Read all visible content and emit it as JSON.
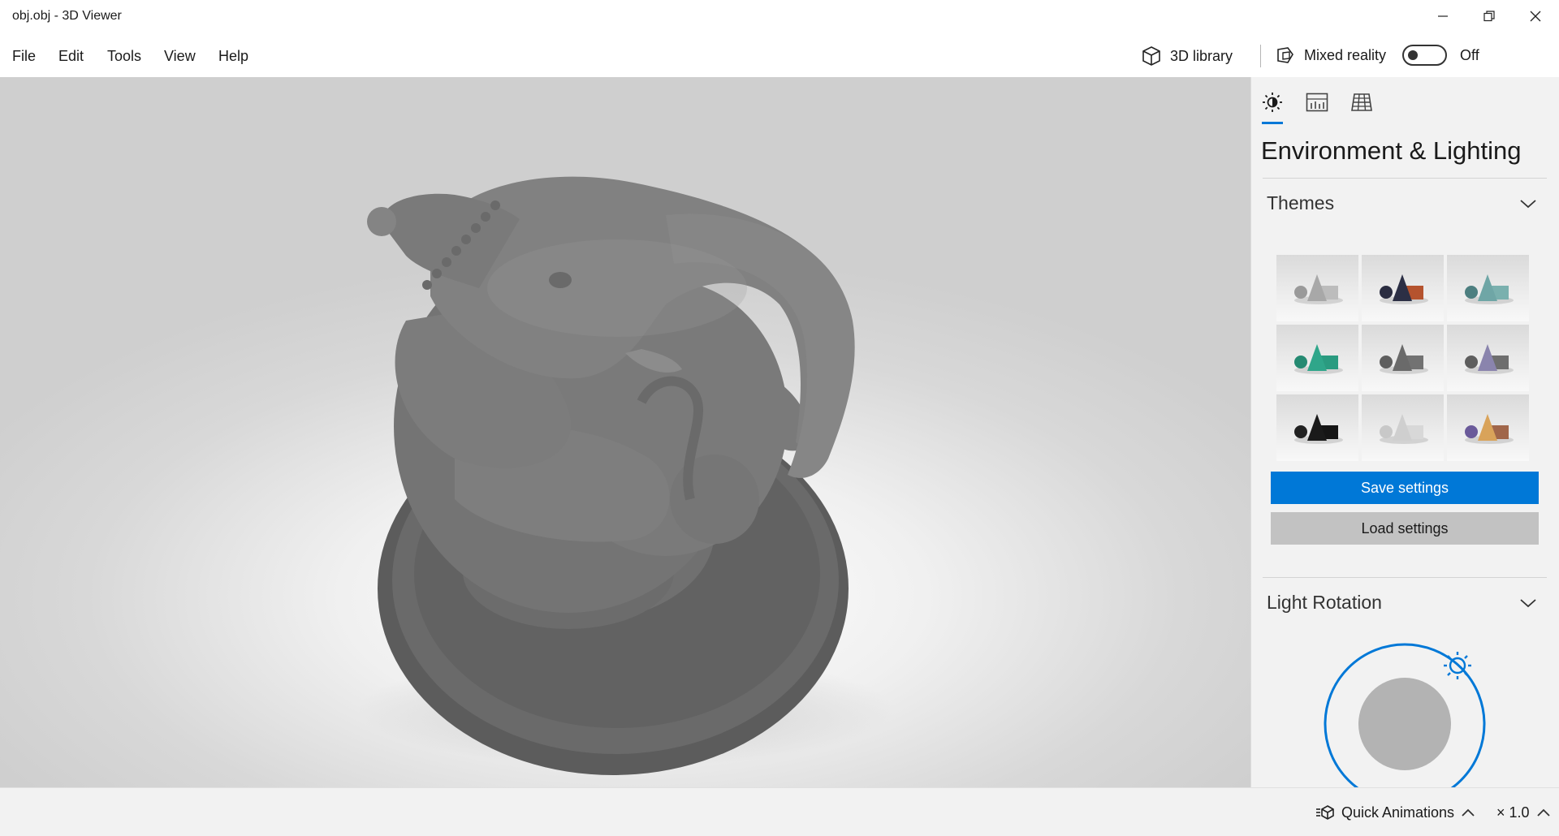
{
  "window": {
    "title": "obj.obj - 3D Viewer",
    "controls": [
      "minimize-icon",
      "restore-icon",
      "close-icon"
    ]
  },
  "menu": {
    "items": [
      {
        "label": "File"
      },
      {
        "label": "Edit"
      },
      {
        "label": "Tools"
      },
      {
        "label": "View"
      },
      {
        "label": "Help"
      }
    ],
    "library_label": "3D library",
    "mixed_reality_label": "Mixed reality",
    "mixed_reality_state": "Off"
  },
  "panel": {
    "tabs": [
      {
        "name": "environment-lighting",
        "icon": "sun-icon",
        "selected": true
      },
      {
        "name": "stats-shading",
        "icon": "chart-icon",
        "selected": false
      },
      {
        "name": "grid-view",
        "icon": "grid-icon",
        "selected": false
      }
    ],
    "heading": "Environment & Lighting",
    "themes": {
      "title": "Themes",
      "items": [
        {
          "cone": "#a8a8a8",
          "box": "#bcbcbc",
          "sphere": "#9a9a9a"
        },
        {
          "cone": "#2c2f45",
          "box": "#b5532e",
          "sphere": "#2a2c40"
        },
        {
          "cone": "#6fa6a6",
          "box": "#7ab0ae",
          "sphere": "#4d7f80"
        },
        {
          "cone": "#2fa68a",
          "box": "#2a9b80",
          "sphere": "#258a72"
        },
        {
          "cone": "#6a6a6a",
          "box": "#727272",
          "sphere": "#5e5e5e"
        },
        {
          "cone": "#8a84ad",
          "box": "#6e6e6e",
          "sphere": "#5e5e5e"
        },
        {
          "cone": "#1a1a1a",
          "box": "#151515",
          "sphere": "#222222"
        },
        {
          "cone": "#cfcfcf",
          "box": "#d8d8d8",
          "sphere": "#c8c8c8"
        },
        {
          "cone": "#d9a35a",
          "box": "#a0664a",
          "sphere": "#6a5a9a"
        }
      ]
    },
    "save_label": "Save settings",
    "load_label": "Load settings",
    "light_rotation_title": "Light Rotation"
  },
  "bottom": {
    "quick_animations_label": "Quick Animations",
    "speed_label": "× 1.0"
  },
  "colors": {
    "accent": "#0078d7",
    "panel_bg": "#f2f2f2",
    "model_gray": "#6e6e6e"
  }
}
